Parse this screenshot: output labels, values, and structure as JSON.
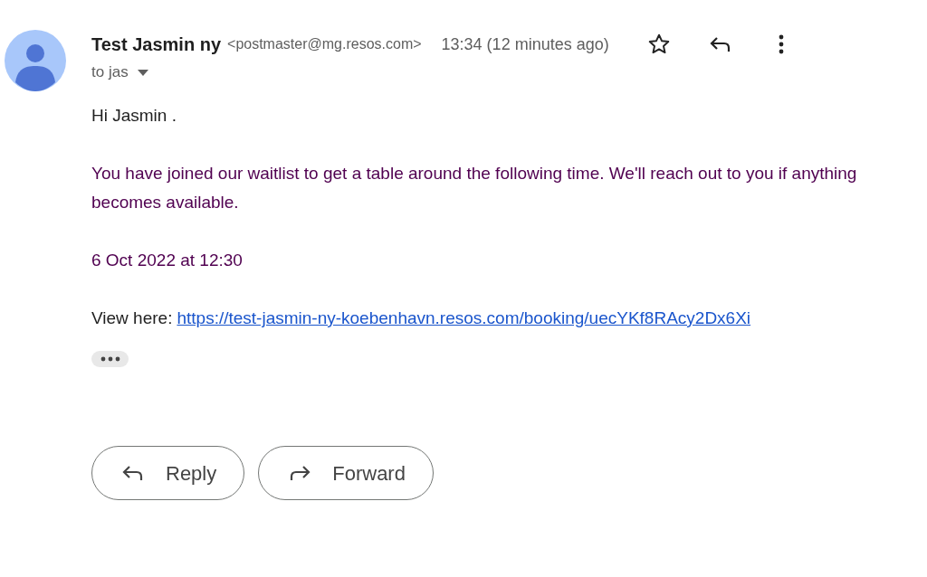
{
  "sender": {
    "name": "Test Jasmin ny",
    "address": "<postmaster@mg.resos.com>",
    "time": "13:34 (12 minutes ago)",
    "recipient": "to jas",
    "starred": false
  },
  "body": {
    "greeting": "Hi Jasmin .",
    "message": "You have joined our waitlist to get a table around the following time. We'll reach out to you if anything becomes available.",
    "date": "6 Oct 2022 at 12:30",
    "link_label": "View here:",
    "link": "https://test-jasmin-ny-koebenhavn.resos.com/booking/uecYKf8RAcy2Dx6Xi"
  },
  "actions": [
    {
      "kind": "reply",
      "label": "Reply"
    },
    {
      "kind": "forward",
      "label": "Forward"
    }
  ]
}
